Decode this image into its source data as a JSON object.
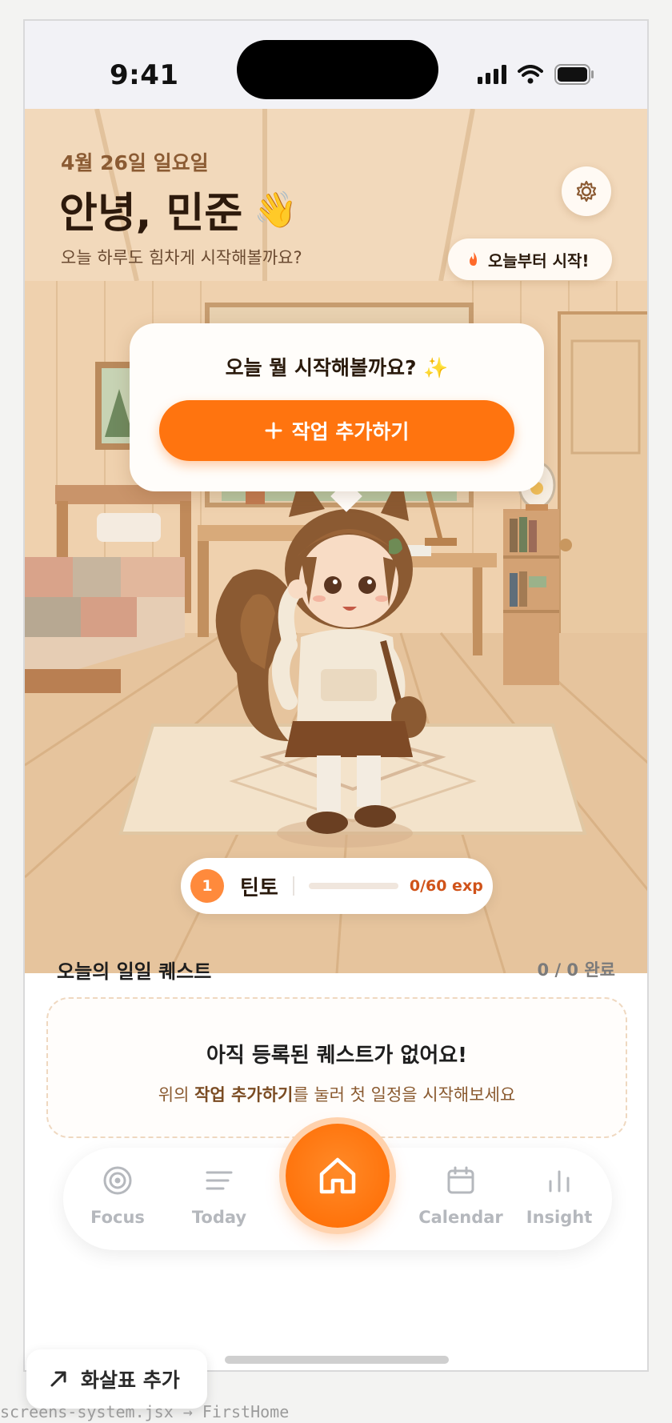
{
  "status_bar": {
    "time": "9:41"
  },
  "header": {
    "date": "4월 26일 일요일",
    "greeting": "안녕, 민준",
    "greeting_emoji": "👋",
    "subtitle": "오늘 하루도 힘차게 시작해볼까요?"
  },
  "settings": {
    "icon": "gear-icon"
  },
  "streak": {
    "icon": "flame-icon",
    "label": "오늘부터 시작!"
  },
  "bubble": {
    "title": "오늘 뭘 시작해볼까요?",
    "title_emoji": "✨",
    "add_task_label": "작업 추가하기"
  },
  "character": {
    "level": "1",
    "name": "틴토",
    "exp_text": "0/60 exp",
    "exp_progress": 0
  },
  "quests": {
    "title": "오늘의 일일 퀘스트",
    "count": "0 / 0 완료",
    "empty_title": "아직 등록된 퀘스트가 없어요!",
    "empty_desc_pre": "위의 ",
    "empty_desc_emph": "작업 추가하기",
    "empty_desc_post": "를 눌러 첫 일정을 시작해보세요"
  },
  "tabbar": {
    "items": [
      {
        "label": "Focus",
        "icon": "focus-target-icon"
      },
      {
        "label": "Today",
        "icon": "list-lines-icon"
      },
      {
        "label": "Home",
        "icon": "home-icon"
      },
      {
        "label": "Calendar",
        "icon": "calendar-icon"
      },
      {
        "label": "Insight",
        "icon": "bar-chart-icon"
      }
    ]
  },
  "overlay": {
    "arrow_button_label": "화살표 추가",
    "source_path": "screens-system.jsx → FirstHome"
  },
  "colors": {
    "accent": "#ff740f",
    "hero_bg": "#f0d3b1",
    "text_dark": "#2a1a0c",
    "tab_inactive": "#b5b8bd"
  }
}
